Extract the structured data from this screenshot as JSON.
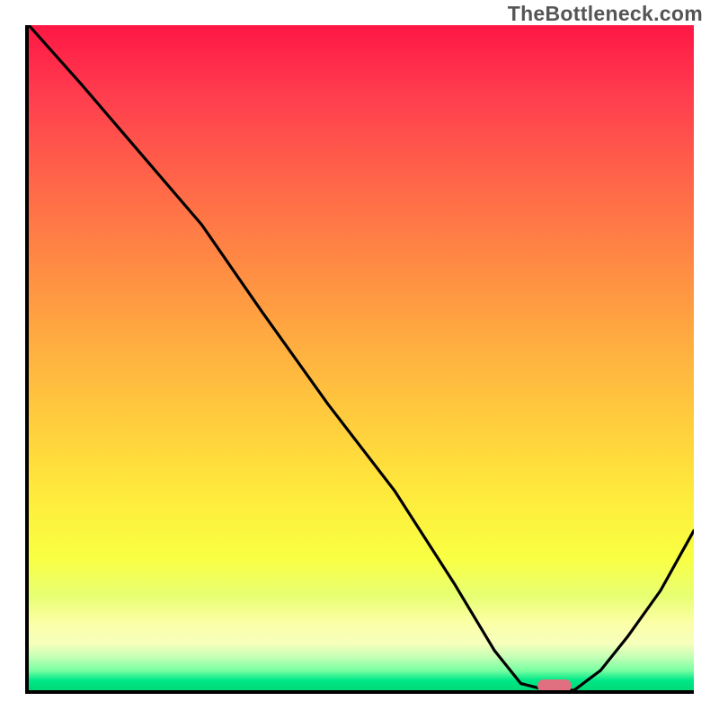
{
  "watermark": "TheBottleneck.com",
  "chart_data": {
    "type": "line",
    "title": "",
    "xlabel": "",
    "ylabel": "",
    "xlim": [
      0,
      100
    ],
    "ylim": [
      0,
      100
    ],
    "grid": false,
    "legend": false,
    "background": "rainbow-gradient-red-to-green",
    "series": [
      {
        "name": "bottleneck-curve",
        "color": "#000000",
        "x": [
          0,
          8,
          20,
          26,
          35,
          45,
          55,
          64,
          70,
          74,
          78,
          82,
          86,
          90,
          95,
          100
        ],
        "values": [
          100,
          91,
          77,
          70,
          57,
          43,
          30,
          16,
          6,
          1,
          0,
          0,
          3,
          8,
          15,
          24
        ]
      }
    ],
    "marker": {
      "name": "optimal-range",
      "x": 79,
      "y": 0,
      "color": "#e07080"
    },
    "gradient_stops": [
      {
        "pct": 0,
        "color": "#ff1744"
      },
      {
        "pct": 50,
        "color": "#ffce3d"
      },
      {
        "pct": 80,
        "color": "#f9ff42"
      },
      {
        "pct": 100,
        "color": "#00d877"
      }
    ]
  }
}
